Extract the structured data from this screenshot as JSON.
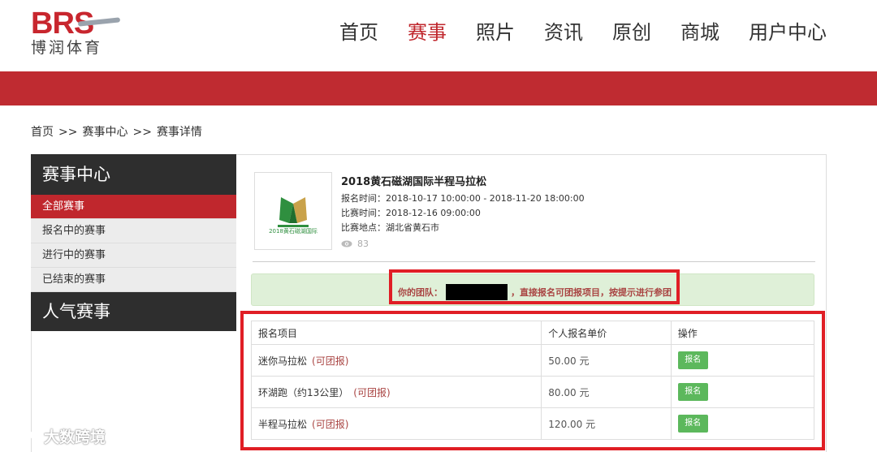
{
  "header": {
    "logo_brs": "BRS",
    "logo_cn": "博润体育",
    "nav": [
      {
        "label": "首页",
        "active": false
      },
      {
        "label": "赛事",
        "active": true
      },
      {
        "label": "照片",
        "active": false
      },
      {
        "label": "资讯",
        "active": false
      },
      {
        "label": "原创",
        "active": false
      },
      {
        "label": "商城",
        "active": false
      },
      {
        "label": "用户中心",
        "active": false
      }
    ],
    "brand_color": "#bf2b31"
  },
  "breadcrumb": {
    "home": "首页",
    "sep": ">>",
    "center": "赛事中心",
    "detail": "赛事详情"
  },
  "sidebar": {
    "title": "赛事中心",
    "items": [
      {
        "label": "全部赛事",
        "active": true
      },
      {
        "label": "报名中的赛事",
        "active": false
      },
      {
        "label": "进行中的赛事",
        "active": false
      },
      {
        "label": "已结束的赛事",
        "active": false
      }
    ],
    "title2": "人气赛事"
  },
  "event": {
    "logo_text": "2018黄石磁湖国际",
    "title": "2018黄石磁湖国际半程马拉松",
    "register_time": "报名时间：2018-10-17 10:00:00 - 2018-11-20 18:00:00",
    "race_time": "比赛时间：2018-12-16 09:00:00",
    "location": "比赛地点：湖北省黄石市",
    "views": "83"
  },
  "notice": {
    "prefix": "你的团队：",
    "suffix": "，直接报名可团报项目，按提示进行参团"
  },
  "table": {
    "headers": [
      "报名项目",
      "个人报名单价",
      "操作"
    ],
    "rows": [
      {
        "name": "迷你马拉松",
        "tag": "(可团报)",
        "price": "50.00 元",
        "action": "报名"
      },
      {
        "name": "环湖跑（约13公里）",
        "tag": "(可团报)",
        "price": "80.00 元",
        "action": "报名"
      },
      {
        "name": "半程马拉松",
        "tag": "(可团报)",
        "price": "120.00 元",
        "action": "报名"
      }
    ]
  },
  "watermark": "大数跨境"
}
